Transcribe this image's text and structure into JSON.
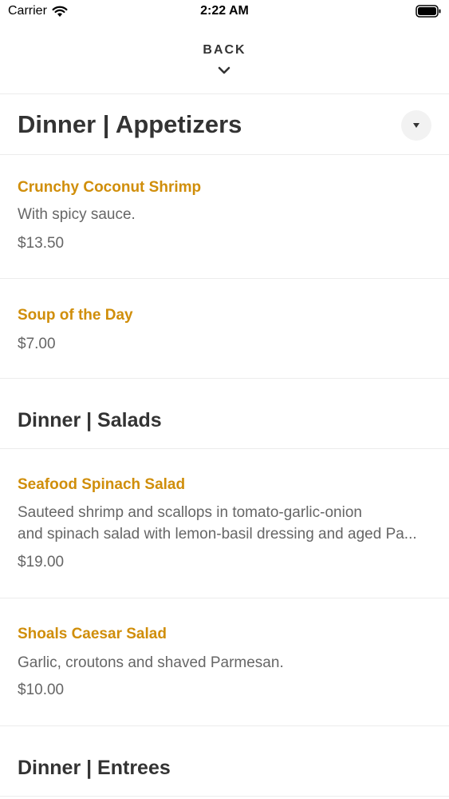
{
  "status_bar": {
    "carrier": "Carrier",
    "time": "2:22 AM",
    "wifi_icon": "wifi-icon",
    "battery_icon": "battery-icon"
  },
  "nav": {
    "back_label": "BACK",
    "back_icon": "chevron-down-icon"
  },
  "colors": {
    "item_name": "#d08e0a",
    "heading": "#333333",
    "body_text": "#666666",
    "divider": "#ececec"
  },
  "sections": [
    {
      "title": "Dinner | Appetizers",
      "dropdown_icon": "caret-down-icon",
      "items": [
        {
          "name": "Crunchy Coconut Shrimp",
          "description": "With spicy sauce.",
          "price": "$13.50"
        },
        {
          "name": "Soup of the Day",
          "price": "$7.00"
        }
      ]
    },
    {
      "title": "Dinner | Salads",
      "items": [
        {
          "name": "Seafood Spinach Salad",
          "description_lines": [
            "Sauteed shrimp and scallops in tomato-garlic-onion",
            "and spinach salad with lemon-basil dressing and aged Pa..."
          ],
          "price": "$19.00"
        },
        {
          "name": "Shoals Caesar Salad",
          "description": "Garlic, croutons and shaved Parmesan.",
          "price": "$10.00"
        }
      ]
    },
    {
      "title": "Dinner | Entrees"
    }
  ]
}
